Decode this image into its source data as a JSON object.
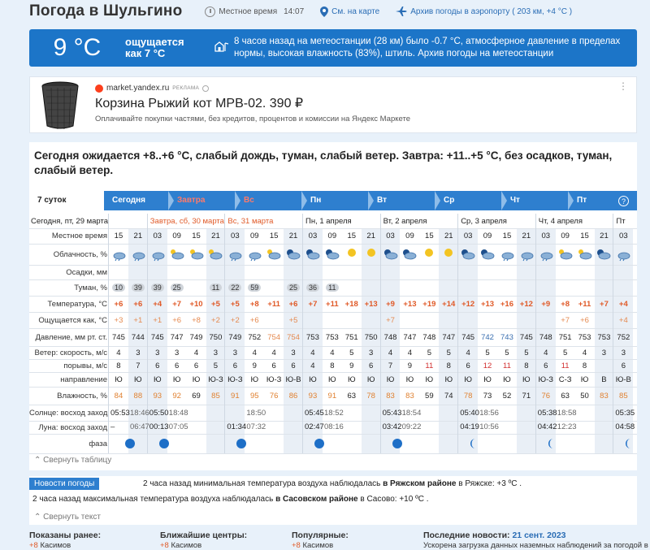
{
  "header": {
    "title": "Погода в Шульгино",
    "local_time_label": "Местное время",
    "local_time": "14:07",
    "map_link": "См. на карте",
    "airport_link": "Архив погоды в аэропорту ( 203 км, +4 °С )"
  },
  "now": {
    "temp": "9 °С",
    "feels_line1": "ощущается",
    "feels_line2": "как 7 °С",
    "desc": "8 часов назад на метеостанции (28 км) было -0.7 °C, атмосферное давление в пределах нормы, высокая влажность (83%), штиль. Архив погоды на метеостанции"
  },
  "ad": {
    "source": "market.yandex.ru",
    "tag": "РЕКЛАМА",
    "title": "Корзина Рыжий кот MPB-02. 390 ₽",
    "subtitle": "Оплачивайте покупки частями, без кредитов, процентов и комиссии на Яндекс Маркете"
  },
  "summary": "Сегодня ожидается +8..+6 °С, слабый дождь, туман, слабый ветер. Завтра: +11..+5 °С, без осадков, туман, слабый ветер.",
  "tabs": [
    "7 суток",
    "Сегодня",
    "Завтра",
    "Вс",
    "Пн",
    "Вт",
    "Ср",
    "Чт",
    "Пт"
  ],
  "help": "?",
  "days": [
    {
      "label": "Сегодня, пт, 29 марта",
      "red": false
    },
    {
      "label": "Завтра, сб, 30 марта",
      "red": true
    },
    {
      "label": "Вс, 31 марта",
      "red": true
    },
    {
      "label": "Пн, 1 апреля",
      "red": false
    },
    {
      "label": "Вт, 2 апреля",
      "red": false
    },
    {
      "label": "Ср, 3 апреля",
      "red": false
    },
    {
      "label": "Чт, 4 апреля",
      "red": false
    },
    {
      "label": "Пт",
      "red": false
    }
  ],
  "row_labels": {
    "time": "Местное время",
    "clouds": "Облачность, %",
    "precip": "Осадки, мм",
    "fog": "Туман, %",
    "temp": "Температура, °С",
    "feels": "Ощущается как, °С",
    "pressure": "Давление, мм рт. ст.",
    "wind_speed": "Ветер: скорость, м/с",
    "gusts": "порывы, м/с",
    "direction": "направление",
    "humidity": "Влажность, %",
    "sun": "Солнце: восход заход",
    "moon": "Луна: восход заход",
    "phase": "фаза"
  },
  "hours": [
    "15",
    "21",
    "03",
    "09",
    "15",
    "21",
    "03",
    "09",
    "15",
    "21",
    "03",
    "09",
    "15",
    "21",
    "03",
    "09",
    "15",
    "21",
    "03",
    "09",
    "15",
    "21",
    "03",
    "09",
    "15",
    "21",
    "03"
  ],
  "clouds": [
    "c",
    "c",
    "c",
    "s",
    "s",
    "s",
    "c",
    "c",
    "s",
    "m",
    "m",
    "m",
    "sun",
    "sun",
    "m",
    "m",
    "sun",
    "sun",
    "m",
    "m",
    "c",
    "c",
    "c",
    "s",
    "s",
    "m",
    "c"
  ],
  "fog": [
    "10",
    "39",
    "39",
    "25",
    "",
    "11",
    "22",
    "59",
    "",
    "25",
    "36",
    "11",
    "",
    "",
    "",
    "",
    "",
    "",
    "",
    "",
    "",
    "",
    "",
    "",
    "",
    "",
    ""
  ],
  "temp": [
    "+6",
    "+6",
    "+4",
    "+7",
    "+10",
    "+5",
    "+5",
    "+8",
    "+11",
    "+6",
    "+7",
    "+11",
    "+18",
    "+13",
    "+9",
    "+13",
    "+19",
    "+14",
    "+12",
    "+13",
    "+16",
    "+12",
    "+9",
    "+8",
    "+11",
    "+7",
    "+4"
  ],
  "feels": [
    "+3",
    "+1",
    "+1",
    "+6",
    "+8",
    "+2",
    "+2",
    "+6",
    "",
    "+5",
    "",
    "",
    "",
    "",
    "+7",
    "",
    "",
    "",
    "",
    "",
    "",
    "",
    "",
    "+7",
    "+6",
    "",
    "+4"
  ],
  "pressure": [
    "745",
    "744",
    "745",
    "747",
    "749",
    "750",
    "749",
    "752",
    "754",
    "754",
    "753",
    "753",
    "751",
    "750",
    "748",
    "747",
    "748",
    "747",
    "745",
    "742",
    "743",
    "745",
    "748",
    "751",
    "753",
    "753",
    "752"
  ],
  "wind_speed": [
    "4",
    "3",
    "3",
    "3",
    "4",
    "3",
    "3",
    "4",
    "4",
    "3",
    "4",
    "4",
    "5",
    "3",
    "4",
    "4",
    "5",
    "5",
    "4",
    "5",
    "5",
    "5",
    "4",
    "5",
    "4",
    "3",
    "3"
  ],
  "gusts": [
    "8",
    "7",
    "6",
    "6",
    "6",
    "5",
    "6",
    "9",
    "6",
    "6",
    "4",
    "8",
    "9",
    "6",
    "7",
    "9",
    "11",
    "8",
    "6",
    "12",
    "11",
    "8",
    "6",
    "11",
    "8",
    "",
    "6"
  ],
  "direction": [
    "Ю",
    "Ю",
    "Ю",
    "Ю",
    "Ю",
    "Ю-З",
    "Ю-З",
    "Ю",
    "Ю-З",
    "Ю-В",
    "Ю",
    "Ю",
    "Ю",
    "Ю",
    "Ю",
    "Ю",
    "Ю",
    "Ю",
    "Ю",
    "Ю",
    "Ю",
    "Ю",
    "Ю-З",
    "С-З",
    "Ю",
    "В",
    "Ю-В"
  ],
  "humidity": [
    "84",
    "88",
    "93",
    "92",
    "69",
    "85",
    "91",
    "95",
    "76",
    "86",
    "93",
    "91",
    "63",
    "78",
    "83",
    "83",
    "59",
    "74",
    "78",
    "73",
    "52",
    "71",
    "76",
    "63",
    "50",
    "83",
    "85"
  ],
  "sun": [
    {
      "rise": "05:53",
      "set": "18:46"
    },
    {
      "rise": "05:50",
      "set": "18:48"
    },
    {
      "rise": "",
      "set": "18:50"
    },
    {
      "rise": "05:45",
      "set": "18:52"
    },
    {
      "rise": "05:43",
      "set": "18:54"
    },
    {
      "rise": "05:40",
      "set": "18:56"
    },
    {
      "rise": "05:38",
      "set": "18:58"
    },
    {
      "rise": "05:35",
      "set": ""
    }
  ],
  "moon": [
    {
      "rise": "–",
      "set": "06:47"
    },
    {
      "rise": "00:13",
      "set": "07:05"
    },
    {
      "rise": "01:34",
      "set": "07:32"
    },
    {
      "rise": "02:47",
      "set": "08:16"
    },
    {
      "rise": "03:42",
      "set": "09:22"
    },
    {
      "rise": "04:19",
      "set": "10:56"
    },
    {
      "rise": "04:42",
      "set": "12:23"
    },
    {
      "rise": "04:58",
      "set": ""
    }
  ],
  "collapse_table": "Свернуть таблицу",
  "news": {
    "tag": "Новости погоды",
    "line1a": "2 часа назад минимальная температура воздуха наблюдалась ",
    "line1b": "в Ряжском районе",
    "line1c": " в Ряжске: +3 ºC .",
    "line2a": "2 часа назад максимальная температура воздуха наблюдалась ",
    "line2b": "в Сасовском районе",
    "line2c": " в Сасово: +10 ºC .",
    "collapse": "Свернуть текст"
  },
  "footer": {
    "shown": "Показаны ранее:",
    "near": "Ближайшие центры:",
    "popular": "Популярные:",
    "latest": "Последние новости:",
    "latest_date": "21 сент. 2023",
    "item1": "Касимов",
    "item2": "Касимов",
    "item3": "Касимов",
    "latest_text": "Ускорена загрузка данных наземных наблюдений за погодой в"
  },
  "colors": {
    "accent": "#1c75c8",
    "tab_bg": "#2e7fcf",
    "warm": "#e05a28"
  }
}
